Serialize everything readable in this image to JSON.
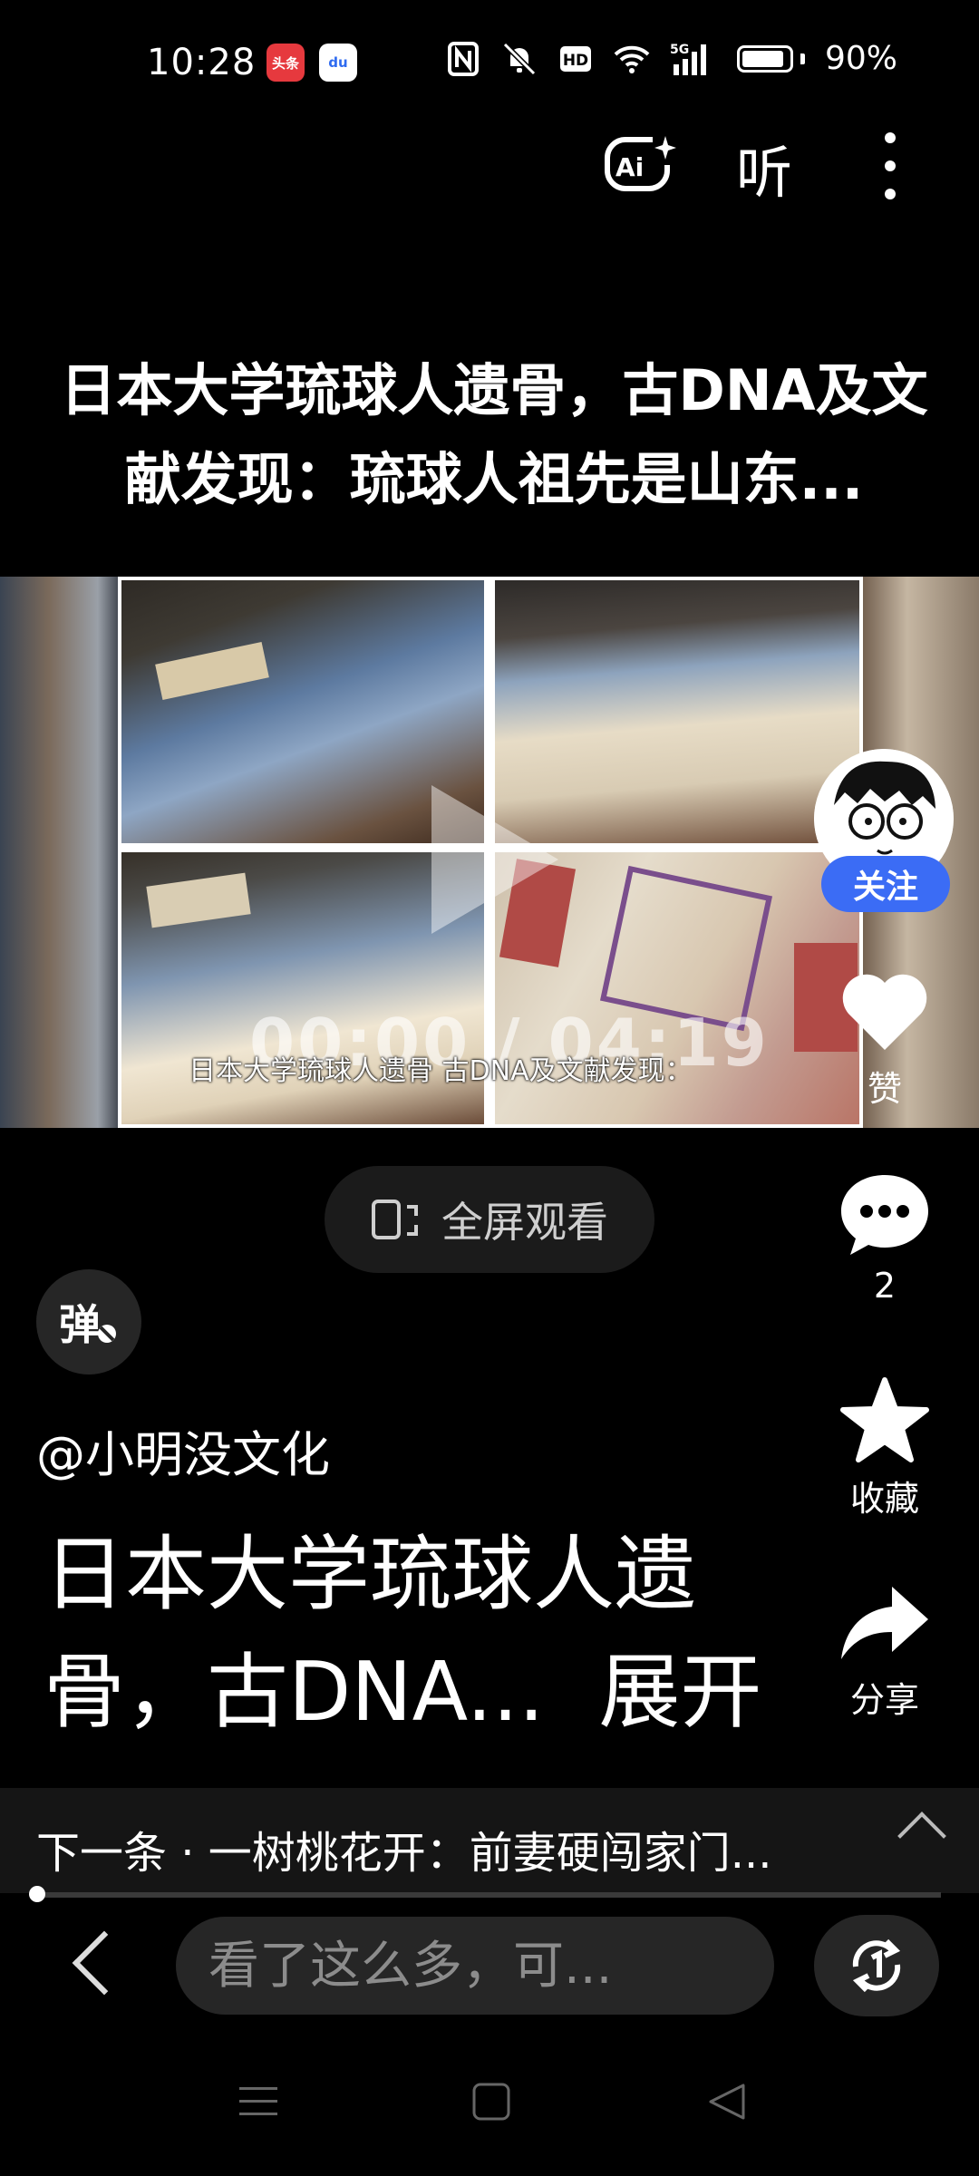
{
  "status_bar": {
    "time": "10:28",
    "app_badges": [
      "头条",
      "du"
    ],
    "signal": "5G",
    "battery": "90%",
    "battery_level": 0.9,
    "icons": [
      "nfc-icon",
      "mute-icon",
      "hd-icon",
      "wifi-icon",
      "signal-icon",
      "battery-icon"
    ]
  },
  "toolbar": {
    "ai_label": "Ai",
    "listen_label": "听",
    "icons": [
      "ai-icon",
      "more-icon"
    ]
  },
  "title": "日本大学琉球人遗骨，古DNA及文献发现：琉球人祖先是山东...",
  "video": {
    "time_display": "00:00 / 04:19",
    "subtitle": "日本大学琉球人遗骨 古DNA及文献发现：",
    "icons": [
      "play-icon"
    ]
  },
  "fullscreen": {
    "label": "全屏观看",
    "icon": "fullscreen-icon"
  },
  "danmaku": {
    "label": "弹"
  },
  "rail": {
    "follow_label": "关注",
    "like_label": "赞",
    "comment_count": "2",
    "favorite_label": "收藏",
    "share_label": "分享",
    "icons": [
      "heart-icon",
      "comment-icon",
      "star-icon",
      "share-icon"
    ]
  },
  "post": {
    "author": "@小明没文化",
    "desc_line1": "日本大学琉球人遗",
    "desc_line2": "骨，古DNA...",
    "expand_label": "展开"
  },
  "next": {
    "text": "下一条 · 一树桃花开：前妻硬闯家门...",
    "icon": "chevron-up-icon",
    "progress": 0.0
  },
  "bottom_bar": {
    "comment_placeholder": "看了这么多，可...",
    "icons": [
      "back-icon",
      "refresh-icon"
    ]
  },
  "nav_bar": {
    "icons": [
      "menu-icon",
      "home-icon",
      "back-triangle-icon"
    ]
  }
}
